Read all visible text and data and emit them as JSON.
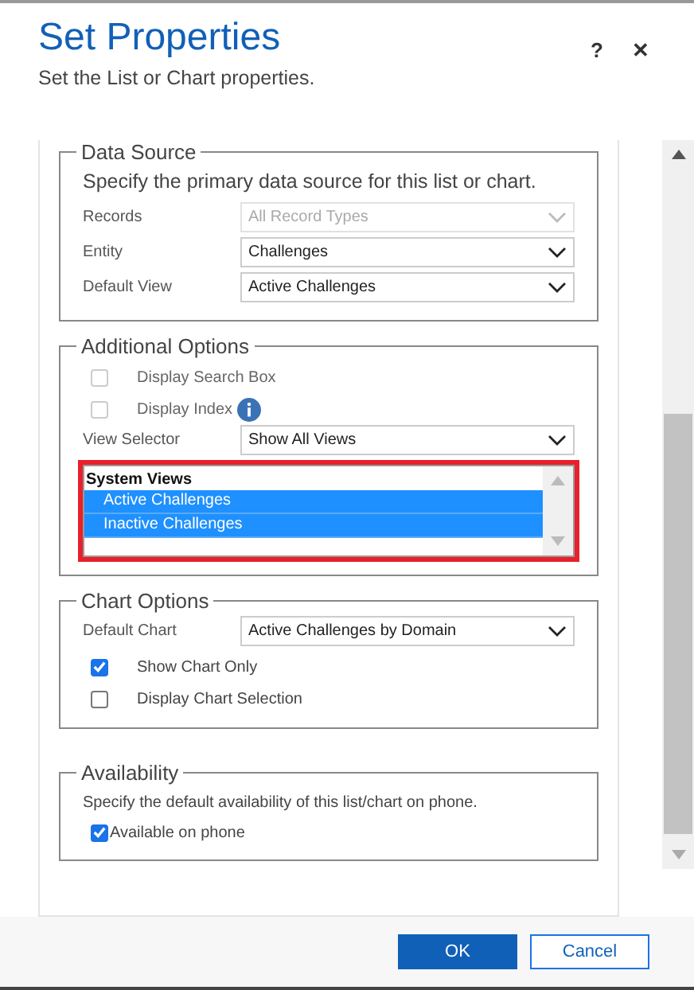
{
  "dialog": {
    "title": "Set Properties",
    "subtitle": "Set the List or Chart properties.",
    "help": "?",
    "close": "✕"
  },
  "data_source": {
    "legend": "Data Source",
    "description": "Specify the primary data source for this list or chart.",
    "fields": [
      {
        "label": "Records",
        "value": "All Record Types",
        "disabled": true
      },
      {
        "label": "Entity",
        "value": "Challenges",
        "disabled": false
      },
      {
        "label": "Default View",
        "value": "Active Challenges",
        "disabled": false
      }
    ]
  },
  "additional_options": {
    "legend": "Additional Options",
    "checkboxes": [
      {
        "label": "Display Search Box",
        "checked": false,
        "disabled": true,
        "info": false
      },
      {
        "label": "Display Index",
        "checked": false,
        "disabled": true,
        "info": true
      }
    ],
    "view_selector": {
      "label": "View Selector",
      "value": "Show All Views"
    },
    "views_list": {
      "highlighted": true,
      "group": "System Views",
      "items": [
        {
          "label": "Active Challenges",
          "selected": true
        },
        {
          "label": "Inactive Challenges",
          "selected": true
        }
      ]
    }
  },
  "chart_options": {
    "legend": "Chart Options",
    "default_chart": {
      "label": "Default Chart",
      "value": "Active Challenges by Domain"
    },
    "checkboxes": [
      {
        "label": "Show Chart Only",
        "checked": true,
        "disabled": false
      },
      {
        "label": "Display Chart Selection",
        "checked": false,
        "disabled": false
      }
    ]
  },
  "availability": {
    "legend": "Availability",
    "description": "Specify the default availability of this list/chart on phone.",
    "checkbox": {
      "label": "Available on phone",
      "checked": true
    }
  },
  "buttons": [
    {
      "label": "OK",
      "kind": "primary"
    },
    {
      "label": "Cancel",
      "kind": "secondary"
    }
  ]
}
